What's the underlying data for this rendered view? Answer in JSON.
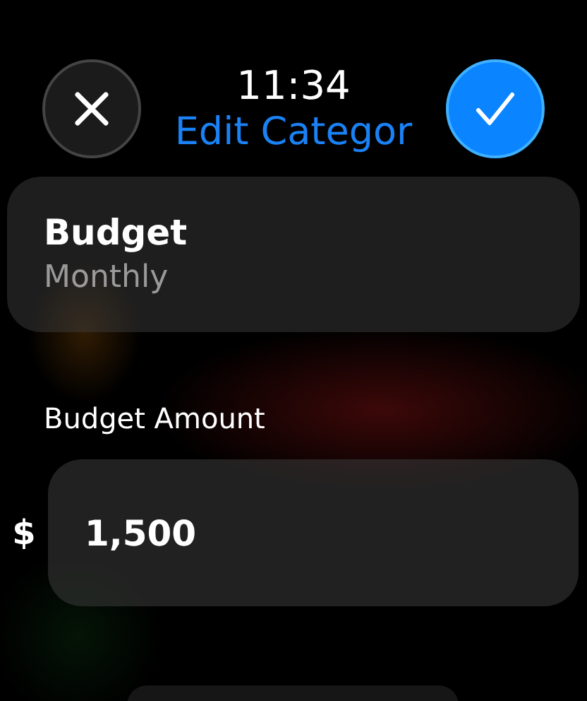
{
  "header": {
    "time": "11:34",
    "title": "Edit Categor"
  },
  "period_row": {
    "label": "Budget",
    "value": "Monthly"
  },
  "amount": {
    "label": "Budget Amount",
    "currency": "$",
    "value": "1,500"
  }
}
